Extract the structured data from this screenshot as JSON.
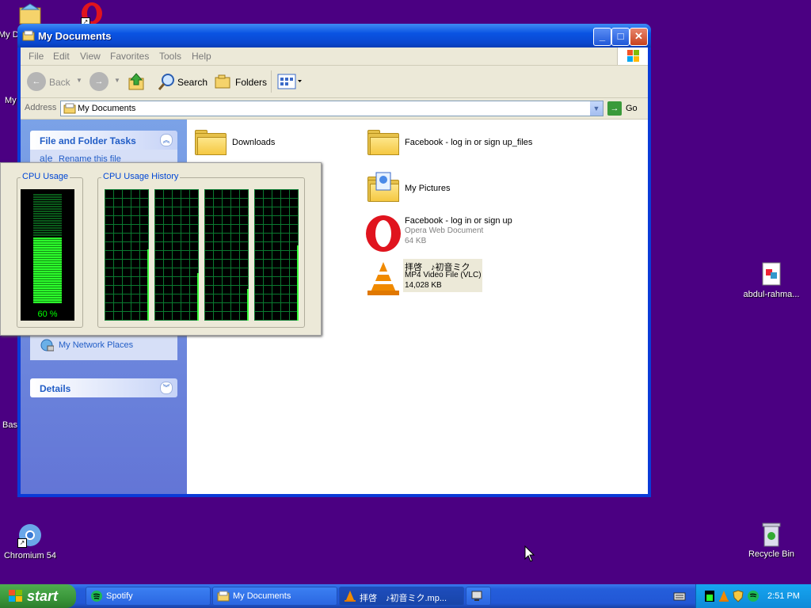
{
  "desktop": {
    "icons": {
      "my_docs_partial": "My D",
      "my_comp_partial": "My",
      "basic_partial": "Basi",
      "chromium": "Chromium 54",
      "abdul": "abdul-rahma...",
      "recycle": "Recycle Bin"
    }
  },
  "window": {
    "title": "My Documents",
    "menu": [
      "File",
      "Edit",
      "View",
      "Favorites",
      "Tools",
      "Help"
    ],
    "toolbar": {
      "back": "Back",
      "search": "Search",
      "folders": "Folders"
    },
    "address": {
      "label": "Address",
      "value": "My Documents",
      "go": "Go"
    }
  },
  "taskpane": {
    "file_tasks": {
      "title": "File and Folder Tasks",
      "rename": "Rename this file"
    },
    "other_places": {
      "network": "My Network Places"
    },
    "details": {
      "title": "Details"
    }
  },
  "files": [
    {
      "name": "Downloads"
    },
    {
      "name": "Facebook - log in or sign up_files"
    },
    {
      "name": "My Pictures"
    },
    {
      "name": "Facebook - log in or sign up",
      "type": "Opera Web Document",
      "size": "64 KB"
    },
    {
      "name": "拝啓　♪初音ミク",
      "type": "MP4 Video File (VLC)",
      "size": "14,028 KB"
    }
  ],
  "cpu_monitor": {
    "usage_label": "CPU Usage",
    "history_label": "CPU Usage History",
    "usage_value": "60 %",
    "usage_fraction": 0.6,
    "accent": "#00ff00"
  },
  "taskbar": {
    "start": "start",
    "tasks": [
      "Spotify",
      "My Documents",
      "拝啓　♪初音ミク.mp..."
    ],
    "clock": "2:51 PM"
  }
}
